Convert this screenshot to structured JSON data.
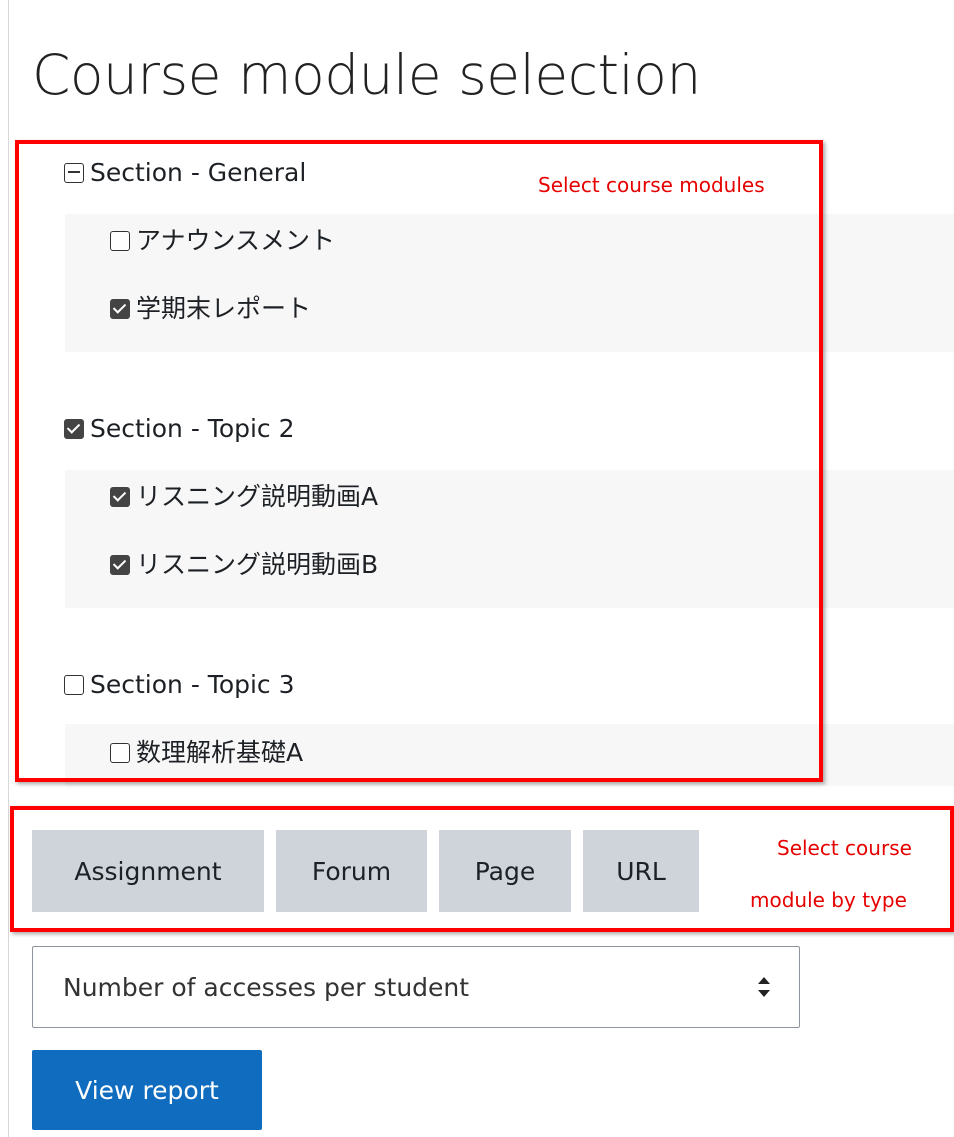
{
  "page_title": "Course module selection",
  "sections": [
    {
      "label": "Section - General",
      "state": "partial",
      "modules": [
        {
          "label": "アナウンスメント",
          "checked": false
        },
        {
          "label": "学期末レポート",
          "checked": true
        }
      ]
    },
    {
      "label": "Section - Topic 2",
      "state": "checked",
      "modules": [
        {
          "label": "リスニング説明動画A",
          "checked": true
        },
        {
          "label": "リスニング説明動画B",
          "checked": true
        }
      ]
    },
    {
      "label": "Section - Topic 3",
      "state": "unchecked",
      "modules": [
        {
          "label": "数理解析基礎A",
          "checked": false
        }
      ]
    }
  ],
  "type_buttons": [
    "Assignment",
    "Forum",
    "Page",
    "URL"
  ],
  "report_select": {
    "value": "Number of accesses per student"
  },
  "view_report_label": "View report",
  "annotations": {
    "modules": "Select course modules",
    "by_type_line1": "Select course",
    "by_type_line2": "module by type"
  },
  "colors": {
    "annotation": "#ff0000",
    "primary": "#0f6cbf",
    "type_button": "#ced4da"
  }
}
